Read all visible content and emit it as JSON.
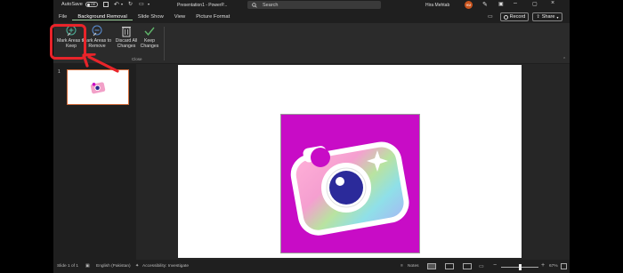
{
  "titlebar": {
    "autosave_label": "AutoSave",
    "autosave_state": "Off",
    "doc_title": "Presentation1 - PowerP...",
    "search_placeholder": "Search",
    "user_name": "Hira Mehtab",
    "user_initials": "HM"
  },
  "tabs": [
    {
      "label": "File",
      "active": false
    },
    {
      "label": "Background Removal",
      "active": true
    },
    {
      "label": "Slide Show",
      "active": false
    },
    {
      "label": "View",
      "active": false
    },
    {
      "label": "Picture Format",
      "active": false
    }
  ],
  "actions": {
    "record_label": "Record",
    "share_label": "Share"
  },
  "ribbon": {
    "mark_keep": "Mark Areas to Keep",
    "mark_remove": "Mark Areas to Remove",
    "discard": "Discard All Changes",
    "keep": "Keep Changes",
    "group_label": "Close"
  },
  "slides_pane": {
    "slide_number": "1"
  },
  "statusbar": {
    "slide_info": "Slide 1 of 1",
    "language": "English (Pakistan)",
    "accessibility": "Accessibility: Investigate",
    "notes": "Notes",
    "zoom": "67%"
  },
  "colors": {
    "accent": "#e8242a",
    "slide_image_bg": "#c80cc6",
    "active_tab_underline": "#9cd09c"
  }
}
